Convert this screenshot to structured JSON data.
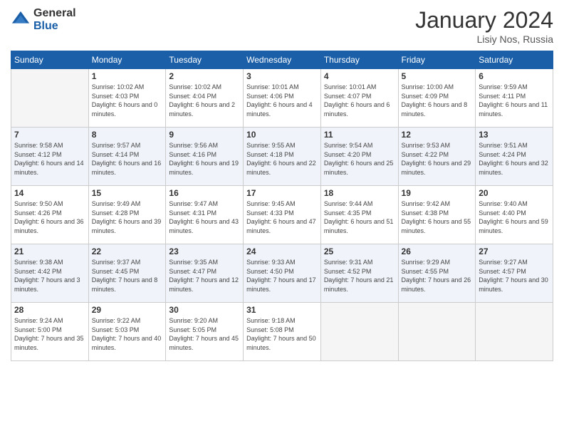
{
  "header": {
    "logo_general": "General",
    "logo_blue": "Blue",
    "month_title": "January 2024",
    "location": "Lisiy Nos, Russia"
  },
  "days_of_week": [
    "Sunday",
    "Monday",
    "Tuesday",
    "Wednesday",
    "Thursday",
    "Friday",
    "Saturday"
  ],
  "weeks": [
    [
      {
        "day": "",
        "sunrise": "",
        "sunset": "",
        "daylight": ""
      },
      {
        "day": "1",
        "sunrise": "Sunrise: 10:02 AM",
        "sunset": "Sunset: 4:03 PM",
        "daylight": "Daylight: 6 hours and 0 minutes."
      },
      {
        "day": "2",
        "sunrise": "Sunrise: 10:02 AM",
        "sunset": "Sunset: 4:04 PM",
        "daylight": "Daylight: 6 hours and 2 minutes."
      },
      {
        "day": "3",
        "sunrise": "Sunrise: 10:01 AM",
        "sunset": "Sunset: 4:06 PM",
        "daylight": "Daylight: 6 hours and 4 minutes."
      },
      {
        "day": "4",
        "sunrise": "Sunrise: 10:01 AM",
        "sunset": "Sunset: 4:07 PM",
        "daylight": "Daylight: 6 hours and 6 minutes."
      },
      {
        "day": "5",
        "sunrise": "Sunrise: 10:00 AM",
        "sunset": "Sunset: 4:09 PM",
        "daylight": "Daylight: 6 hours and 8 minutes."
      },
      {
        "day": "6",
        "sunrise": "Sunrise: 9:59 AM",
        "sunset": "Sunset: 4:11 PM",
        "daylight": "Daylight: 6 hours and 11 minutes."
      }
    ],
    [
      {
        "day": "7",
        "sunrise": "Sunrise: 9:58 AM",
        "sunset": "Sunset: 4:12 PM",
        "daylight": "Daylight: 6 hours and 14 minutes."
      },
      {
        "day": "8",
        "sunrise": "Sunrise: 9:57 AM",
        "sunset": "Sunset: 4:14 PM",
        "daylight": "Daylight: 6 hours and 16 minutes."
      },
      {
        "day": "9",
        "sunrise": "Sunrise: 9:56 AM",
        "sunset": "Sunset: 4:16 PM",
        "daylight": "Daylight: 6 hours and 19 minutes."
      },
      {
        "day": "10",
        "sunrise": "Sunrise: 9:55 AM",
        "sunset": "Sunset: 4:18 PM",
        "daylight": "Daylight: 6 hours and 22 minutes."
      },
      {
        "day": "11",
        "sunrise": "Sunrise: 9:54 AM",
        "sunset": "Sunset: 4:20 PM",
        "daylight": "Daylight: 6 hours and 25 minutes."
      },
      {
        "day": "12",
        "sunrise": "Sunrise: 9:53 AM",
        "sunset": "Sunset: 4:22 PM",
        "daylight": "Daylight: 6 hours and 29 minutes."
      },
      {
        "day": "13",
        "sunrise": "Sunrise: 9:51 AM",
        "sunset": "Sunset: 4:24 PM",
        "daylight": "Daylight: 6 hours and 32 minutes."
      }
    ],
    [
      {
        "day": "14",
        "sunrise": "Sunrise: 9:50 AM",
        "sunset": "Sunset: 4:26 PM",
        "daylight": "Daylight: 6 hours and 36 minutes."
      },
      {
        "day": "15",
        "sunrise": "Sunrise: 9:49 AM",
        "sunset": "Sunset: 4:28 PM",
        "daylight": "Daylight: 6 hours and 39 minutes."
      },
      {
        "day": "16",
        "sunrise": "Sunrise: 9:47 AM",
        "sunset": "Sunset: 4:31 PM",
        "daylight": "Daylight: 6 hours and 43 minutes."
      },
      {
        "day": "17",
        "sunrise": "Sunrise: 9:45 AM",
        "sunset": "Sunset: 4:33 PM",
        "daylight": "Daylight: 6 hours and 47 minutes."
      },
      {
        "day": "18",
        "sunrise": "Sunrise: 9:44 AM",
        "sunset": "Sunset: 4:35 PM",
        "daylight": "Daylight: 6 hours and 51 minutes."
      },
      {
        "day": "19",
        "sunrise": "Sunrise: 9:42 AM",
        "sunset": "Sunset: 4:38 PM",
        "daylight": "Daylight: 6 hours and 55 minutes."
      },
      {
        "day": "20",
        "sunrise": "Sunrise: 9:40 AM",
        "sunset": "Sunset: 4:40 PM",
        "daylight": "Daylight: 6 hours and 59 minutes."
      }
    ],
    [
      {
        "day": "21",
        "sunrise": "Sunrise: 9:38 AM",
        "sunset": "Sunset: 4:42 PM",
        "daylight": "Daylight: 7 hours and 3 minutes."
      },
      {
        "day": "22",
        "sunrise": "Sunrise: 9:37 AM",
        "sunset": "Sunset: 4:45 PM",
        "daylight": "Daylight: 7 hours and 8 minutes."
      },
      {
        "day": "23",
        "sunrise": "Sunrise: 9:35 AM",
        "sunset": "Sunset: 4:47 PM",
        "daylight": "Daylight: 7 hours and 12 minutes."
      },
      {
        "day": "24",
        "sunrise": "Sunrise: 9:33 AM",
        "sunset": "Sunset: 4:50 PM",
        "daylight": "Daylight: 7 hours and 17 minutes."
      },
      {
        "day": "25",
        "sunrise": "Sunrise: 9:31 AM",
        "sunset": "Sunset: 4:52 PM",
        "daylight": "Daylight: 7 hours and 21 minutes."
      },
      {
        "day": "26",
        "sunrise": "Sunrise: 9:29 AM",
        "sunset": "Sunset: 4:55 PM",
        "daylight": "Daylight: 7 hours and 26 minutes."
      },
      {
        "day": "27",
        "sunrise": "Sunrise: 9:27 AM",
        "sunset": "Sunset: 4:57 PM",
        "daylight": "Daylight: 7 hours and 30 minutes."
      }
    ],
    [
      {
        "day": "28",
        "sunrise": "Sunrise: 9:24 AM",
        "sunset": "Sunset: 5:00 PM",
        "daylight": "Daylight: 7 hours and 35 minutes."
      },
      {
        "day": "29",
        "sunrise": "Sunrise: 9:22 AM",
        "sunset": "Sunset: 5:03 PM",
        "daylight": "Daylight: 7 hours and 40 minutes."
      },
      {
        "day": "30",
        "sunrise": "Sunrise: 9:20 AM",
        "sunset": "Sunset: 5:05 PM",
        "daylight": "Daylight: 7 hours and 45 minutes."
      },
      {
        "day": "31",
        "sunrise": "Sunrise: 9:18 AM",
        "sunset": "Sunset: 5:08 PM",
        "daylight": "Daylight: 7 hours and 50 minutes."
      },
      {
        "day": "",
        "sunrise": "",
        "sunset": "",
        "daylight": ""
      },
      {
        "day": "",
        "sunrise": "",
        "sunset": "",
        "daylight": ""
      },
      {
        "day": "",
        "sunrise": "",
        "sunset": "",
        "daylight": ""
      }
    ]
  ]
}
